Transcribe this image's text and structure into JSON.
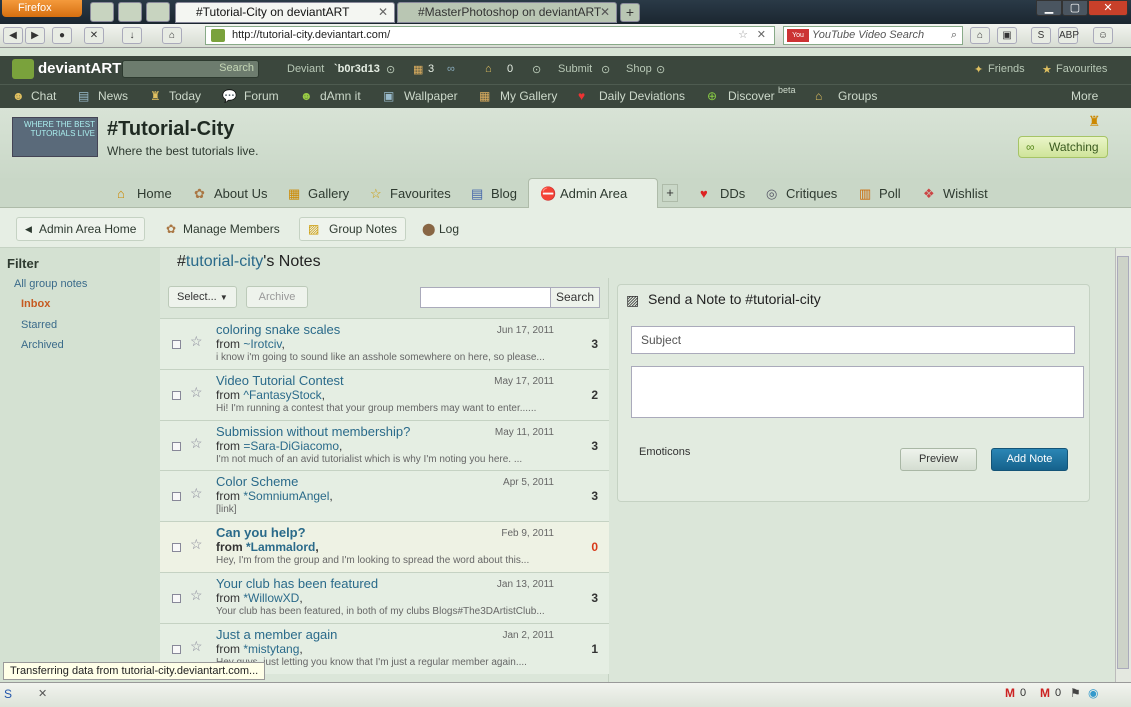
{
  "browser": {
    "menu_button": "Firefox",
    "tabs": [
      {
        "label": "#Tutorial-City on deviantART",
        "active": true
      },
      {
        "label": "#MasterPhotoshop on deviantART",
        "active": false
      }
    ],
    "new_tab": "+",
    "url": "http://tutorial-city.deviantart.com/",
    "search_placeholder": "YouTube Video Search",
    "status_text": "Transferring data from tutorial-city.deviantart.com..."
  },
  "da_header": {
    "logo": "deviantART",
    "search_button": "Search",
    "deviant_label": "Deviant",
    "username": "`b0r3d13",
    "count_a": "3",
    "count_b": "0",
    "submit": "Submit",
    "shop": "Shop",
    "friends": "Friends",
    "favourites": "Favourites"
  },
  "da_menu": [
    "Chat",
    "News",
    "Today",
    "Forum",
    "dAmn it",
    "Wallpaper",
    "My Gallery",
    "Daily Deviations",
    "Discover",
    "Groups",
    "More"
  ],
  "discover_badge": "beta",
  "group": {
    "icon_text": "WHERE THE BEST TUTORIALS LIVE",
    "title": "#Tutorial-City",
    "subtitle": "Where the best tutorials live.",
    "watching": "Watching",
    "tabs": [
      "Home",
      "About Us",
      "Gallery",
      "Favourites",
      "Blog",
      "Admin Area",
      "+",
      "DDs",
      "Critiques",
      "Poll",
      "Wishlist"
    ]
  },
  "subnav": {
    "back": "Admin Area Home",
    "manage": "Manage Members",
    "notes": "Group Notes",
    "log": "Log"
  },
  "filter": {
    "title": "Filter",
    "all": "All group notes",
    "items": [
      "Inbox",
      "Starred",
      "Archived"
    ]
  },
  "notes": {
    "title_prefix": "#",
    "title_group": "tutorial-city",
    "title_suffix": "'s Notes",
    "select": "Select...",
    "archive": "Archive",
    "search_button": "Search",
    "rows": [
      {
        "subject": "coloring snake scales",
        "from_prefix": "from ",
        "user": "~Irotciv",
        "after": ",",
        "preview": "i know i'm going to sound like an asshole somewhere on here, so please...",
        "date": "Jun 17, 2011",
        "count": "3"
      },
      {
        "subject": "Video Tutorial Contest",
        "from_prefix": "from ",
        "user": "^FantasyStock",
        "after": ",",
        "preview": "Hi! I'm running a contest that your group members may want to enter......",
        "date": "May 17, 2011",
        "count": "2"
      },
      {
        "subject": "Submission without membership?",
        "from_prefix": "from ",
        "user": "=Sara-DiGiacomo",
        "after": ",",
        "preview": "I'm not much of an avid tutorialist which is why I'm noting you here. ...",
        "date": "May 11, 2011",
        "count": "3"
      },
      {
        "subject": "Color Scheme",
        "from_prefix": "from ",
        "user": "*SomniumAngel",
        "after": ",",
        "preview": "[link]",
        "date": "Apr 5, 2011",
        "count": "3"
      },
      {
        "subject": "Can you help?",
        "from_prefix": "from ",
        "user": "*Lammalord",
        "after": ",",
        "preview": "Hey, I'm from the group and I'm looking to spread the word about this...",
        "date": "Feb 9, 2011",
        "count": "0"
      },
      {
        "subject": "Your club has been featured",
        "from_prefix": "from ",
        "user": "*WillowXD",
        "after": ",",
        "preview": "Your club has been featured, in both of my clubs Blogs#The3DArtistClub...",
        "date": "Jan 13, 2011",
        "count": "3"
      },
      {
        "subject": "Just a member again",
        "from_prefix": "from ",
        "user": "*mistytang",
        "after": ",",
        "preview": "Hey guys, just letting you know that I'm just a regular member again....",
        "date": "Jan 2, 2011",
        "count": "1"
      }
    ]
  },
  "send_note": {
    "title": "Send a Note to #tutorial-city",
    "subject_placeholder": "Subject",
    "emoticons": "Emoticons",
    "preview": "Preview",
    "add": "Add Note"
  }
}
